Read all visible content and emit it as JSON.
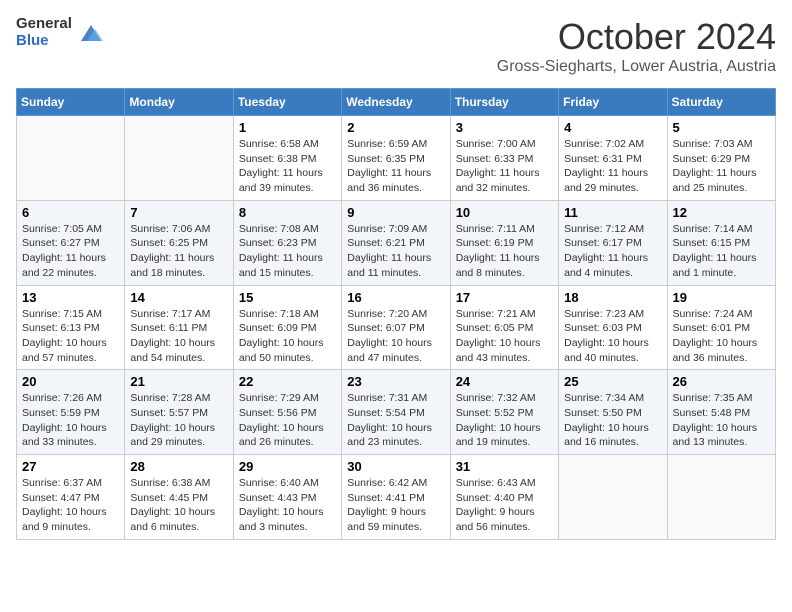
{
  "header": {
    "logo_general": "General",
    "logo_blue": "Blue",
    "month": "October 2024",
    "location": "Gross-Siegharts, Lower Austria, Austria"
  },
  "weekdays": [
    "Sunday",
    "Monday",
    "Tuesday",
    "Wednesday",
    "Thursday",
    "Friday",
    "Saturday"
  ],
  "weeks": [
    [
      {
        "day": "",
        "info": ""
      },
      {
        "day": "",
        "info": ""
      },
      {
        "day": "1",
        "info": "Sunrise: 6:58 AM\nSunset: 6:38 PM\nDaylight: 11 hours and 39 minutes."
      },
      {
        "day": "2",
        "info": "Sunrise: 6:59 AM\nSunset: 6:35 PM\nDaylight: 11 hours and 36 minutes."
      },
      {
        "day": "3",
        "info": "Sunrise: 7:00 AM\nSunset: 6:33 PM\nDaylight: 11 hours and 32 minutes."
      },
      {
        "day": "4",
        "info": "Sunrise: 7:02 AM\nSunset: 6:31 PM\nDaylight: 11 hours and 29 minutes."
      },
      {
        "day": "5",
        "info": "Sunrise: 7:03 AM\nSunset: 6:29 PM\nDaylight: 11 hours and 25 minutes."
      }
    ],
    [
      {
        "day": "6",
        "info": "Sunrise: 7:05 AM\nSunset: 6:27 PM\nDaylight: 11 hours and 22 minutes."
      },
      {
        "day": "7",
        "info": "Sunrise: 7:06 AM\nSunset: 6:25 PM\nDaylight: 11 hours and 18 minutes."
      },
      {
        "day": "8",
        "info": "Sunrise: 7:08 AM\nSunset: 6:23 PM\nDaylight: 11 hours and 15 minutes."
      },
      {
        "day": "9",
        "info": "Sunrise: 7:09 AM\nSunset: 6:21 PM\nDaylight: 11 hours and 11 minutes."
      },
      {
        "day": "10",
        "info": "Sunrise: 7:11 AM\nSunset: 6:19 PM\nDaylight: 11 hours and 8 minutes."
      },
      {
        "day": "11",
        "info": "Sunrise: 7:12 AM\nSunset: 6:17 PM\nDaylight: 11 hours and 4 minutes."
      },
      {
        "day": "12",
        "info": "Sunrise: 7:14 AM\nSunset: 6:15 PM\nDaylight: 11 hours and 1 minute."
      }
    ],
    [
      {
        "day": "13",
        "info": "Sunrise: 7:15 AM\nSunset: 6:13 PM\nDaylight: 10 hours and 57 minutes."
      },
      {
        "day": "14",
        "info": "Sunrise: 7:17 AM\nSunset: 6:11 PM\nDaylight: 10 hours and 54 minutes."
      },
      {
        "day": "15",
        "info": "Sunrise: 7:18 AM\nSunset: 6:09 PM\nDaylight: 10 hours and 50 minutes."
      },
      {
        "day": "16",
        "info": "Sunrise: 7:20 AM\nSunset: 6:07 PM\nDaylight: 10 hours and 47 minutes."
      },
      {
        "day": "17",
        "info": "Sunrise: 7:21 AM\nSunset: 6:05 PM\nDaylight: 10 hours and 43 minutes."
      },
      {
        "day": "18",
        "info": "Sunrise: 7:23 AM\nSunset: 6:03 PM\nDaylight: 10 hours and 40 minutes."
      },
      {
        "day": "19",
        "info": "Sunrise: 7:24 AM\nSunset: 6:01 PM\nDaylight: 10 hours and 36 minutes."
      }
    ],
    [
      {
        "day": "20",
        "info": "Sunrise: 7:26 AM\nSunset: 5:59 PM\nDaylight: 10 hours and 33 minutes."
      },
      {
        "day": "21",
        "info": "Sunrise: 7:28 AM\nSunset: 5:57 PM\nDaylight: 10 hours and 29 minutes."
      },
      {
        "day": "22",
        "info": "Sunrise: 7:29 AM\nSunset: 5:56 PM\nDaylight: 10 hours and 26 minutes."
      },
      {
        "day": "23",
        "info": "Sunrise: 7:31 AM\nSunset: 5:54 PM\nDaylight: 10 hours and 23 minutes."
      },
      {
        "day": "24",
        "info": "Sunrise: 7:32 AM\nSunset: 5:52 PM\nDaylight: 10 hours and 19 minutes."
      },
      {
        "day": "25",
        "info": "Sunrise: 7:34 AM\nSunset: 5:50 PM\nDaylight: 10 hours and 16 minutes."
      },
      {
        "day": "26",
        "info": "Sunrise: 7:35 AM\nSunset: 5:48 PM\nDaylight: 10 hours and 13 minutes."
      }
    ],
    [
      {
        "day": "27",
        "info": "Sunrise: 6:37 AM\nSunset: 4:47 PM\nDaylight: 10 hours and 9 minutes."
      },
      {
        "day": "28",
        "info": "Sunrise: 6:38 AM\nSunset: 4:45 PM\nDaylight: 10 hours and 6 minutes."
      },
      {
        "day": "29",
        "info": "Sunrise: 6:40 AM\nSunset: 4:43 PM\nDaylight: 10 hours and 3 minutes."
      },
      {
        "day": "30",
        "info": "Sunrise: 6:42 AM\nSunset: 4:41 PM\nDaylight: 9 hours and 59 minutes."
      },
      {
        "day": "31",
        "info": "Sunrise: 6:43 AM\nSunset: 4:40 PM\nDaylight: 9 hours and 56 minutes."
      },
      {
        "day": "",
        "info": ""
      },
      {
        "day": "",
        "info": ""
      }
    ]
  ]
}
